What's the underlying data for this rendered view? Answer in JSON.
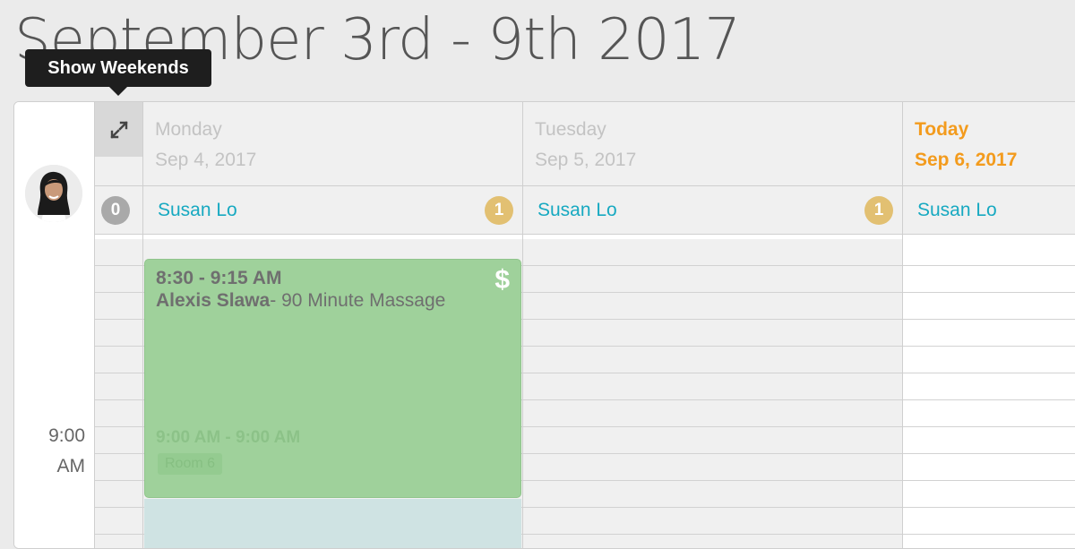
{
  "header": {
    "title": "September 3rd - 9th 2017",
    "tooltip": "Show Weekends"
  },
  "staff": {
    "name": "Susan Lo",
    "avatar_icon": "user-avatar-photo"
  },
  "gutter": {
    "expand_icon": "expand-arrows-icon",
    "count": "0"
  },
  "days": [
    {
      "name": "Monday",
      "date": "Sep 4, 2017",
      "count": "1",
      "staff": "Susan Lo"
    },
    {
      "name": "Tuesday",
      "date": "Sep 5, 2017",
      "count": "1",
      "staff": "Susan Lo"
    },
    {
      "name": "Today",
      "date": "Sep 6, 2017",
      "staff": "Susan Lo"
    }
  ],
  "time_labels": [
    "9:00",
    "AM"
  ],
  "appointment": {
    "time": "8:30 - 9:15 AM",
    "client": "Alexis Slawa",
    "service": "- 90 Minute Massage",
    "dollar": "$",
    "ghost_time": "9:00 AM - 9:00 AM",
    "room": "Room 6"
  },
  "colors": {
    "accent_today": "#f39b1d",
    "staff_link": "#17a9c1",
    "appointment_bg": "#9fd19b",
    "badge_gold": "#e2c072"
  }
}
